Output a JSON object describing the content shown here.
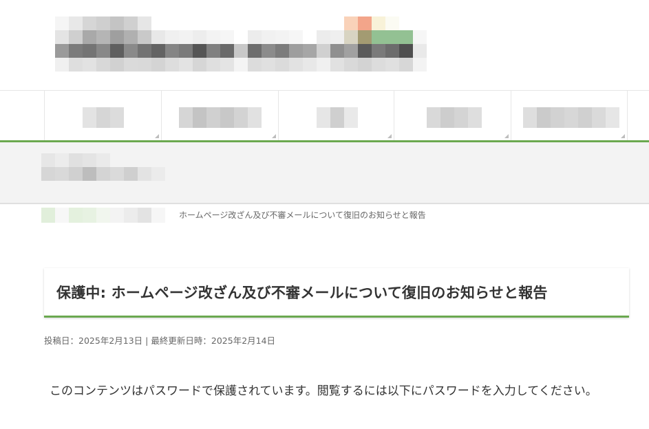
{
  "breadcrumb": {
    "current": "ホームページ改ざん及び不審メールについて復旧のお知らせと報告"
  },
  "article": {
    "title": "保護中: ホームページ改ざん及び不審メールについて復旧のお知らせと報告",
    "posted_label": "投稿日：",
    "posted_date": "2025年2月13日",
    "separator": "|",
    "updated_label": "最終更新日時：",
    "updated_date": "2025年2月14日",
    "body": "このコンテンツはパスワードで保護されています。閲覧するには以下にパスワードを入力してください。"
  },
  "colors": {
    "accent": "#6aa84f",
    "band": "#f3f3f3",
    "text": "#333333",
    "muted": "#666666"
  }
}
